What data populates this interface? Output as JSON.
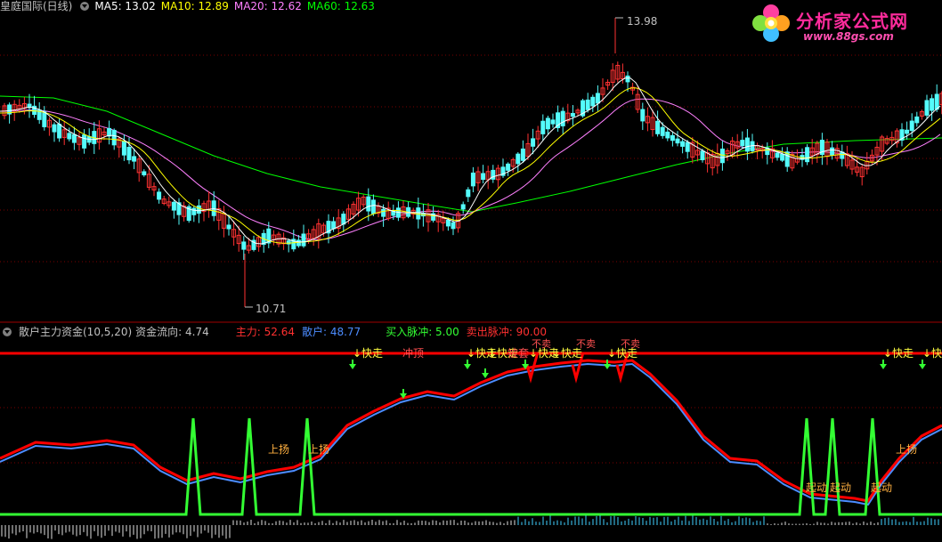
{
  "main_header": {
    "title": "皇庭国际(日线)",
    "ma5": "MA5: 13.02",
    "ma10": "MA10: 12.89",
    "ma20": "MA20: 12.62",
    "ma60": "MA60: 12.63"
  },
  "price_labels": {
    "high": "13.98",
    "low": "10.71"
  },
  "indicator_header": {
    "name": "散户主力资金(10,5,20)",
    "flow": "资金流向: 4.74",
    "main_force": "主力: 52.64",
    "retail": "散户: 48.77",
    "buy_pulse": "买入脉冲: 5.00",
    "sell_pulse": "卖出脉冲: 90.00"
  },
  "signals": {
    "fast_exit": "↓快走",
    "rush_top": "冲顶",
    "rise": "上扬",
    "start": "起动",
    "trapped": "被套",
    "not_sell": "不卖"
  },
  "logo": {
    "brand": "分析家公式网",
    "url": "www.88gs.com"
  },
  "colors": {
    "background": "#000000",
    "up_candle": "#ff3232",
    "down_candle": "#54fcfc",
    "ma5": "#ffffff",
    "ma10": "#ffff00",
    "ma20": "#ff80ff",
    "ma60": "#00ff00",
    "main_force_line": "#ff0000",
    "retail_line": "#4c8cff",
    "pulse_line": "#33ff33"
  }
}
